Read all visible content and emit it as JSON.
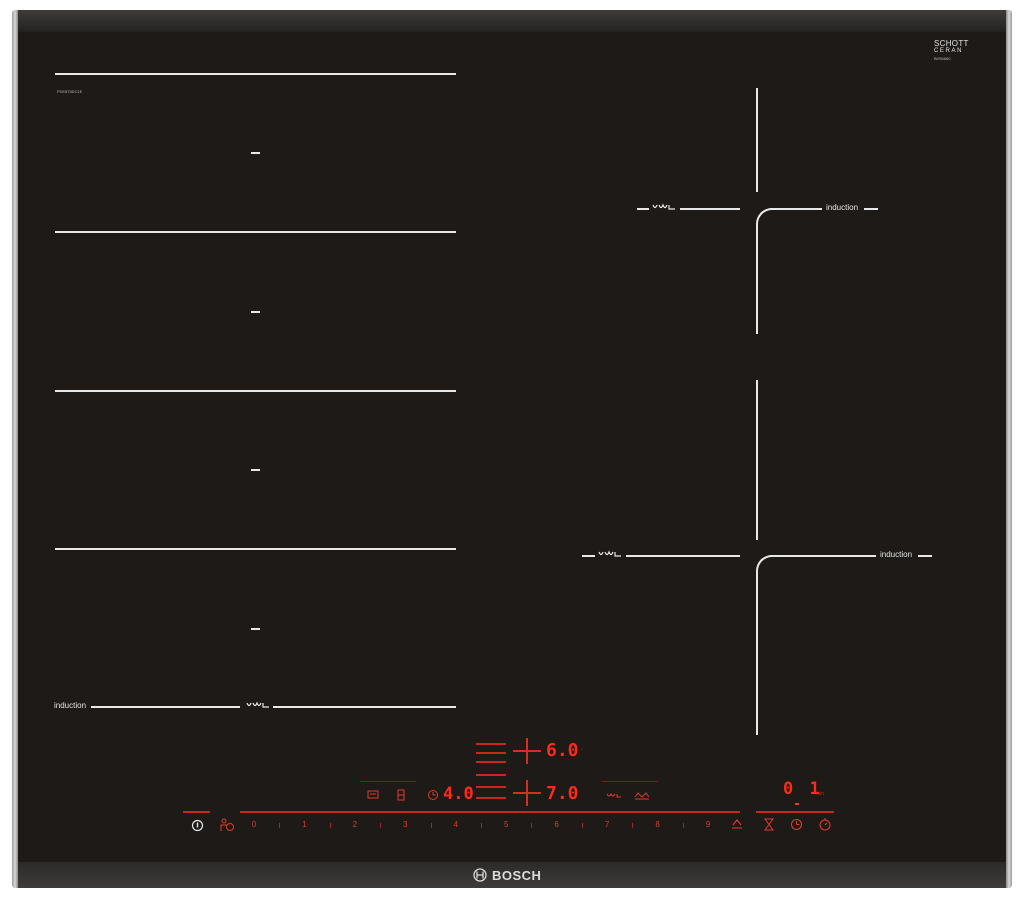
{
  "brand": {
    "name": "BOSCH"
  },
  "glass": {
    "maker_line1": "SCHOTT",
    "maker_line2": "CERAN",
    "maker_small": "B0S6660"
  },
  "model_label": "PXE875DC1E",
  "zones": {
    "left_labels": [
      "induction"
    ],
    "right_top_labels": [
      "induction"
    ],
    "right_bottom_labels": [
      "induction"
    ]
  },
  "control_panel": {
    "power_scale": [
      "0",
      "1",
      "2",
      "3",
      "4",
      "5",
      "6",
      "7",
      "8",
      "9"
    ],
    "readouts": {
      "zone_upper": "6.0",
      "zone_lower": "7.0",
      "left_timer": "4.0",
      "right_timer": "0 1",
      "right_timer_unit": "min"
    },
    "colors": {
      "accent": "#e23b2a",
      "glass": "#1d1a17",
      "print": "#e8e8e8"
    },
    "icons": [
      "power-icon",
      "child-lock-icon",
      "boost-icon",
      "frying-sensor-icon",
      "timer-icon",
      "stopwatch-icon",
      "wipe-protection-icon",
      "flex-zone-icon",
      "move-mode-icon",
      "pan-icon"
    ]
  }
}
